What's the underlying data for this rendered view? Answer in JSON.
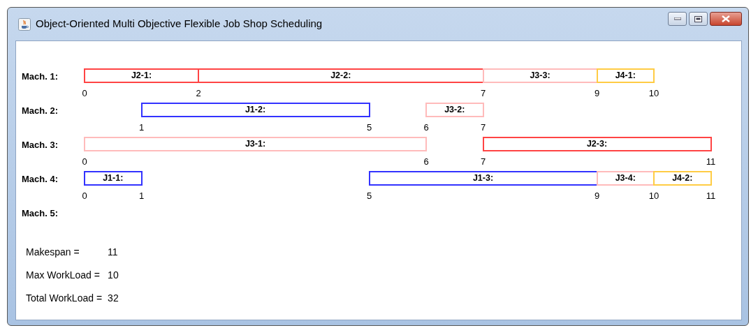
{
  "window": {
    "title": "Object-Oriented Multi Objective Flexible Job Shop Scheduling"
  },
  "machines": [
    {
      "label": "Mach. 1:",
      "tasks": [
        {
          "label": "J2-1:",
          "start": "0",
          "end": "2",
          "color": "#ff4444"
        },
        {
          "label": "J2-2:",
          "end": "7",
          "color": "#ff4444"
        },
        {
          "label": "J3-3:",
          "end": "9",
          "color": "#ffbbbb"
        },
        {
          "label": "J4-1:",
          "end": "10",
          "color": "#ffcc44"
        }
      ]
    },
    {
      "label": "Mach. 2:",
      "tasks": [
        {
          "label": "J1-2:",
          "start": "1",
          "end": "5",
          "color": "#3333ff"
        },
        {
          "label": "J3-2:",
          "start": "6",
          "end": "7",
          "color": "#ffbbbb"
        }
      ]
    },
    {
      "label": "Mach. 3:",
      "tasks": [
        {
          "label": "J3-1:",
          "start": "0",
          "end": "6",
          "color": "#ffbbbb"
        },
        {
          "label": "J2-3:",
          "start": "7",
          "end": "11",
          "color": "#ff4444"
        }
      ]
    },
    {
      "label": "Mach. 4:",
      "tasks": [
        {
          "label": "J1-1:",
          "start": "0",
          "end": "1",
          "color": "#3333ff"
        },
        {
          "label": "J1-3:",
          "start": "5",
          "end": "9",
          "color": "#3333ff"
        },
        {
          "label": "J3-4:",
          "end": "10",
          "color": "#ffbbbb"
        },
        {
          "label": "J4-2:",
          "end": "11",
          "color": "#ffcc44"
        }
      ]
    },
    {
      "label": "Mach. 5:"
    }
  ],
  "stats": [
    {
      "label": "Makespan =",
      "value": "11"
    },
    {
      "label": "Max WorkLoad =",
      "value": "10"
    },
    {
      "label": "Total WorkLoad =",
      "value": "32"
    }
  ]
}
